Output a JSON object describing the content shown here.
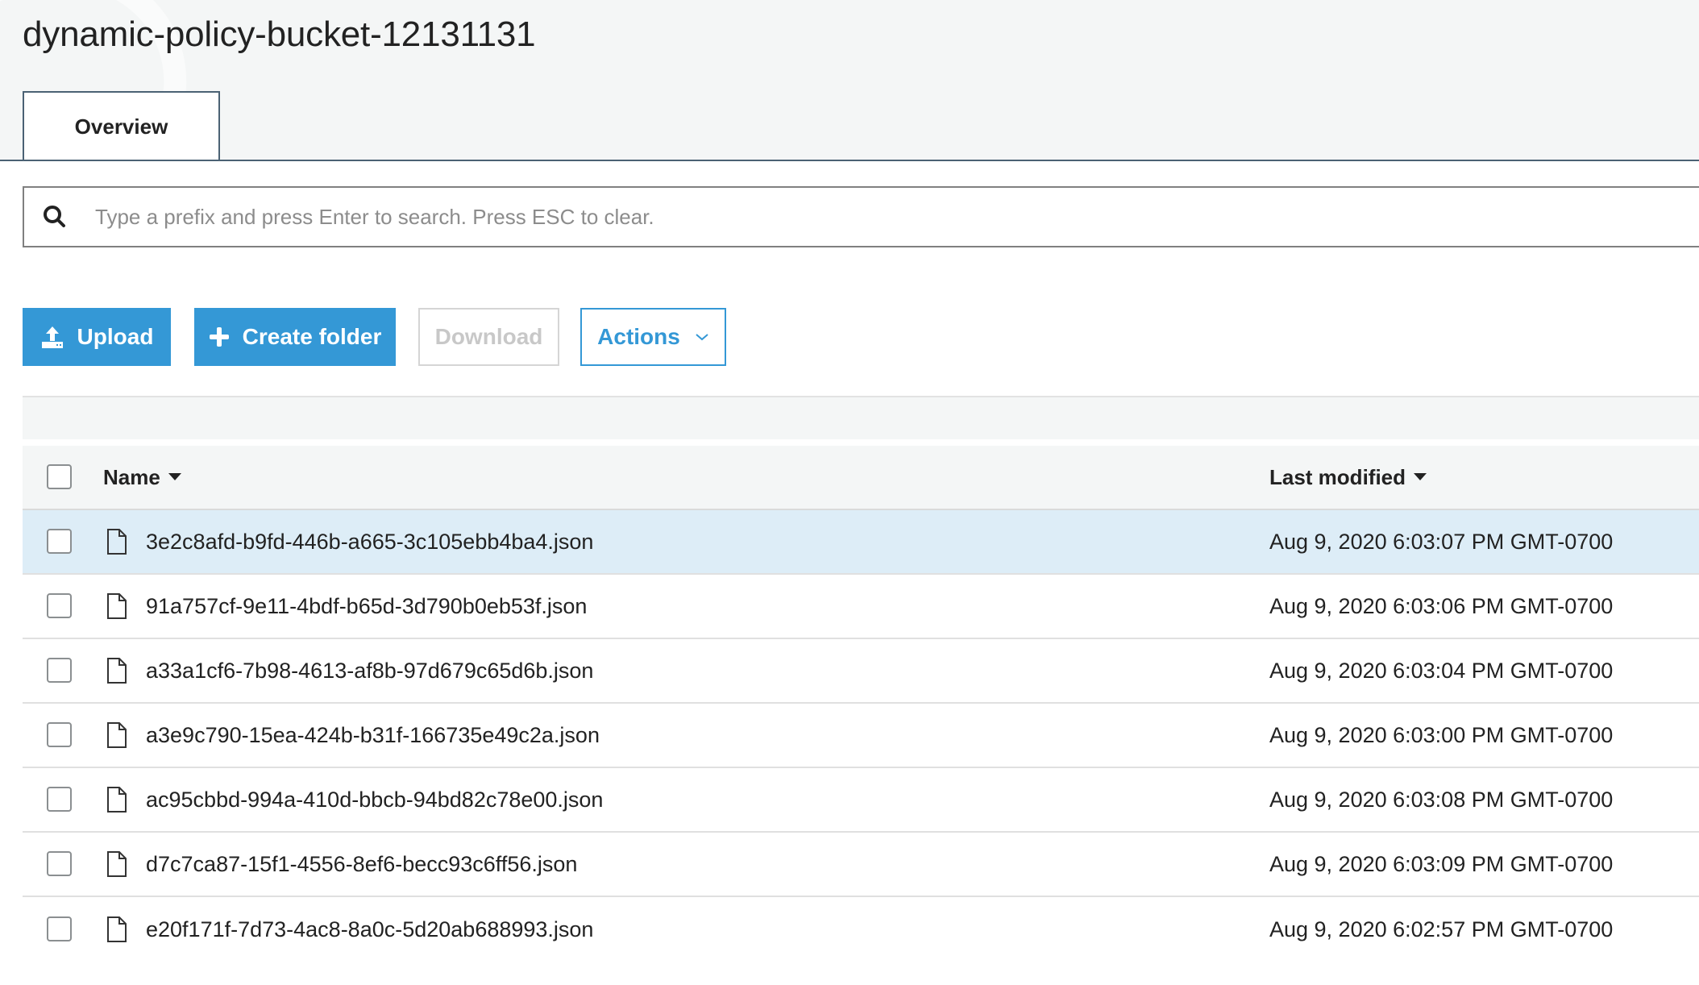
{
  "header": {
    "title": "dynamic-policy-bucket-12131131"
  },
  "tabs": [
    {
      "label": "Overview",
      "active": true
    }
  ],
  "search": {
    "icon": "search-icon",
    "placeholder": "Type a prefix and press Enter to search. Press ESC to clear.",
    "value": ""
  },
  "toolbar": {
    "upload_label": "Upload",
    "upload_icon": "upload-icon",
    "create_folder_label": "Create folder",
    "create_folder_icon": "plus-icon",
    "download_label": "Download",
    "download_disabled": true,
    "actions_label": "Actions",
    "actions_icon": "chevron-down-icon"
  },
  "colors": {
    "primary": "#3498d6",
    "selected_row": "#ddedf7",
    "header_bg": "#f4f6f6",
    "tab_border": "#4b6274"
  },
  "table": {
    "columns": [
      {
        "label": "Name",
        "sort": "descending"
      },
      {
        "label": "Last modified",
        "sort": "descending"
      }
    ],
    "rows": [
      {
        "name": "3e2c8afd-b9fd-446b-a665-3c105ebb4ba4.json",
        "last_modified": "Aug 9, 2020 6:03:07 PM GMT-0700",
        "selected": true
      },
      {
        "name": "91a757cf-9e11-4bdf-b65d-3d790b0eb53f.json",
        "last_modified": "Aug 9, 2020 6:03:06 PM GMT-0700",
        "selected": false
      },
      {
        "name": "a33a1cf6-7b98-4613-af8b-97d679c65d6b.json",
        "last_modified": "Aug 9, 2020 6:03:04 PM GMT-0700",
        "selected": false
      },
      {
        "name": "a3e9c790-15ea-424b-b31f-166735e49c2a.json",
        "last_modified": "Aug 9, 2020 6:03:00 PM GMT-0700",
        "selected": false
      },
      {
        "name": "ac95cbbd-994a-410d-bbcb-94bd82c78e00.json",
        "last_modified": "Aug 9, 2020 6:03:08 PM GMT-0700",
        "selected": false
      },
      {
        "name": "d7c7ca87-15f1-4556-8ef6-becc93c6ff56.json",
        "last_modified": "Aug 9, 2020 6:03:09 PM GMT-0700",
        "selected": false
      },
      {
        "name": "e20f171f-7d73-4ac8-8a0c-5d20ab688993.json",
        "last_modified": "Aug 9, 2020 6:02:57 PM GMT-0700",
        "selected": false
      }
    ]
  }
}
